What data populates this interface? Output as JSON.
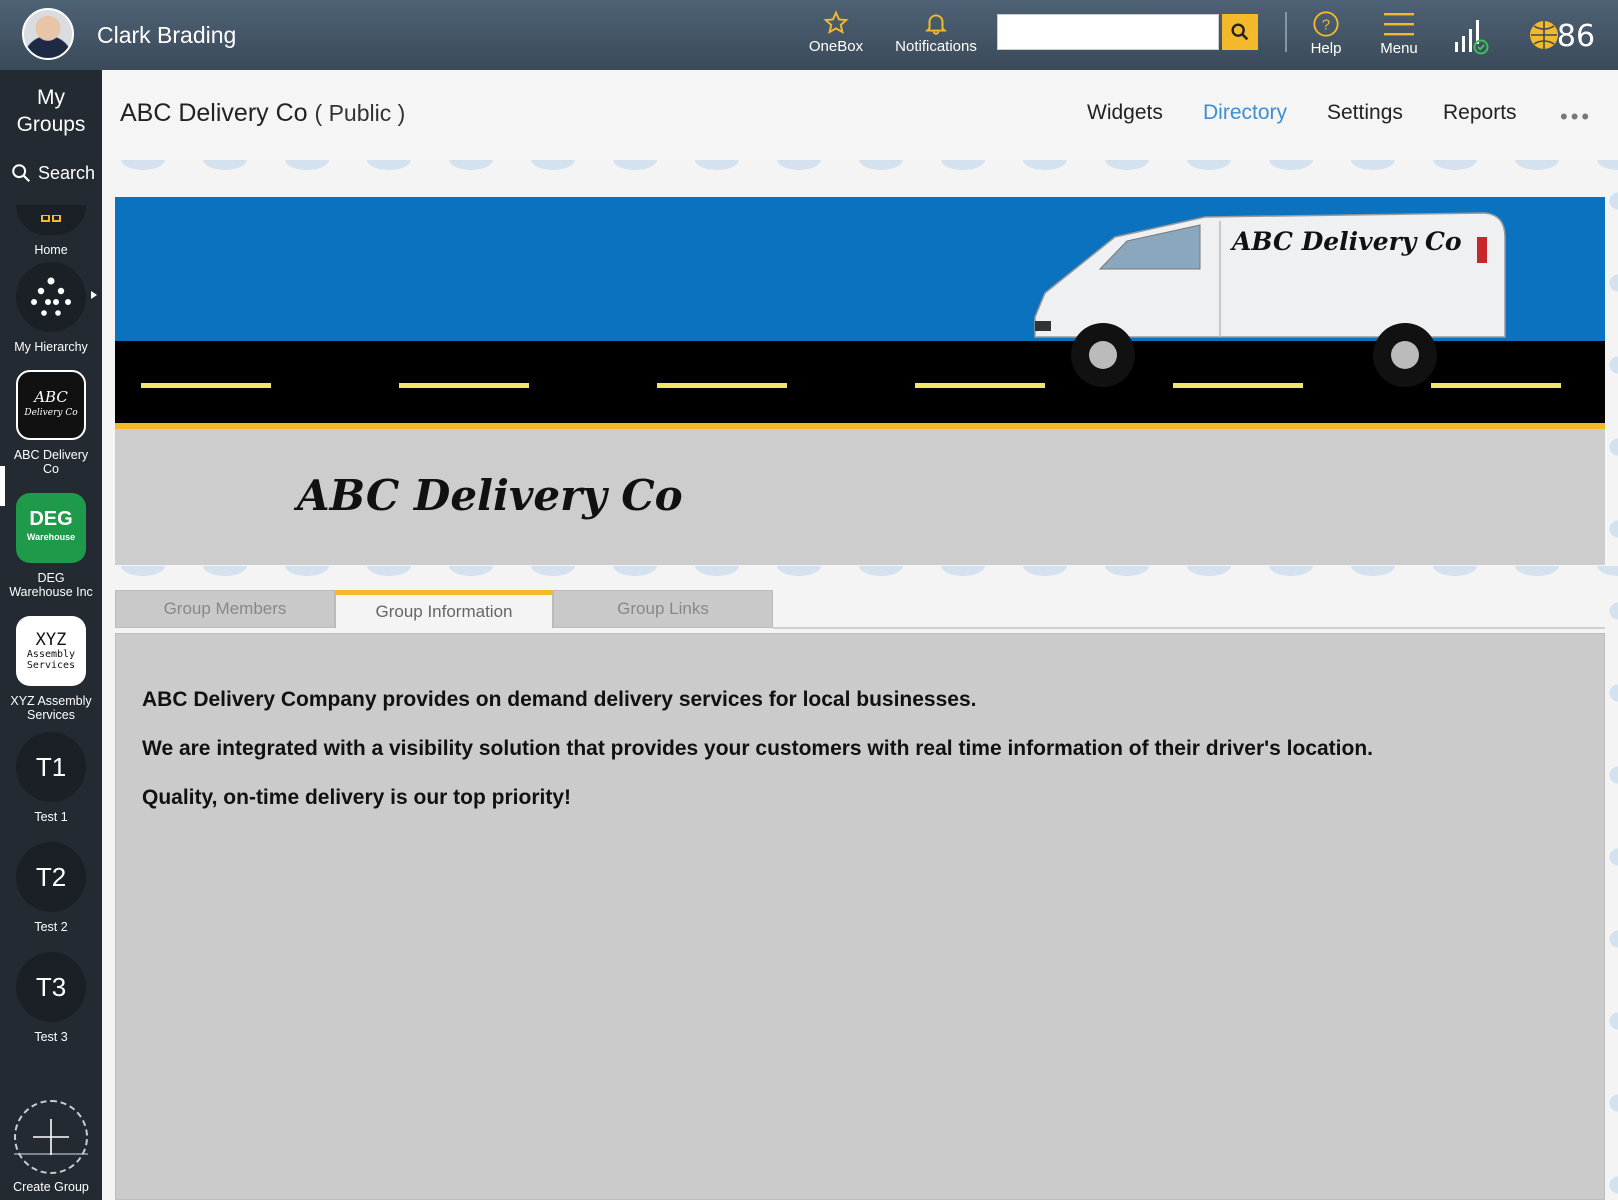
{
  "topbar": {
    "user_name": "Clark Brading",
    "onebox_label": "OneBox",
    "notifications_label": "Notifications",
    "search_placeholder": "",
    "help_label": "Help",
    "menu_label": "Menu"
  },
  "sidebar": {
    "my_groups_label": "My Groups",
    "search_label": "Search",
    "items": [
      {
        "label": "Home",
        "icon": "home-icon"
      },
      {
        "label": "My Hierarchy",
        "icon": "hierarchy-icon"
      },
      {
        "label": "ABC Delivery Co",
        "icon_text_line1": "ABC",
        "icon_text_line2": "Delivery Co"
      },
      {
        "label": "DEG Warehouse Inc",
        "icon_text_line1": "DEG",
        "icon_text_line2": "Warehouse"
      },
      {
        "label": "XYZ Assembly Services",
        "icon_text_line1": "XYZ",
        "icon_text_line2": "Assembly",
        "icon_text_line3": "Services"
      },
      {
        "label": "Test 1",
        "icon_text": "T1"
      },
      {
        "label": "Test 2",
        "icon_text": "T2"
      },
      {
        "label": "Test 3",
        "icon_text": "T3"
      },
      {
        "label": "Create Group",
        "icon": "plus-icon"
      }
    ]
  },
  "group": {
    "name": "ABC Delivery Co",
    "visibility": "( Public )",
    "nav": [
      "Widgets",
      "Directory",
      "Settings",
      "Reports"
    ],
    "active_nav": "Directory",
    "more": "•••",
    "banner_van_text": "ABC Delivery Co",
    "logo_text": "ABC Delivery Co"
  },
  "tabs": {
    "items": [
      "Group Members",
      "Group Information",
      "Group Links"
    ],
    "active": "Group Information"
  },
  "info": {
    "lines": [
      "ABC Delivery Company provides on demand delivery services for local businesses.",
      "We are integrated with a visibility solution that provides your customers with real time information of their driver's location.",
      "Quality, on-time delivery is our top priority!"
    ]
  },
  "colors": {
    "accent_yellow": "#f4b92a",
    "link_blue": "#3b8fd3",
    "sidebar_bg": "#232a31",
    "topbar_bg": "#3a4a59",
    "banner_sky": "#0a72bf",
    "deg_green": "#1e9a4a"
  }
}
